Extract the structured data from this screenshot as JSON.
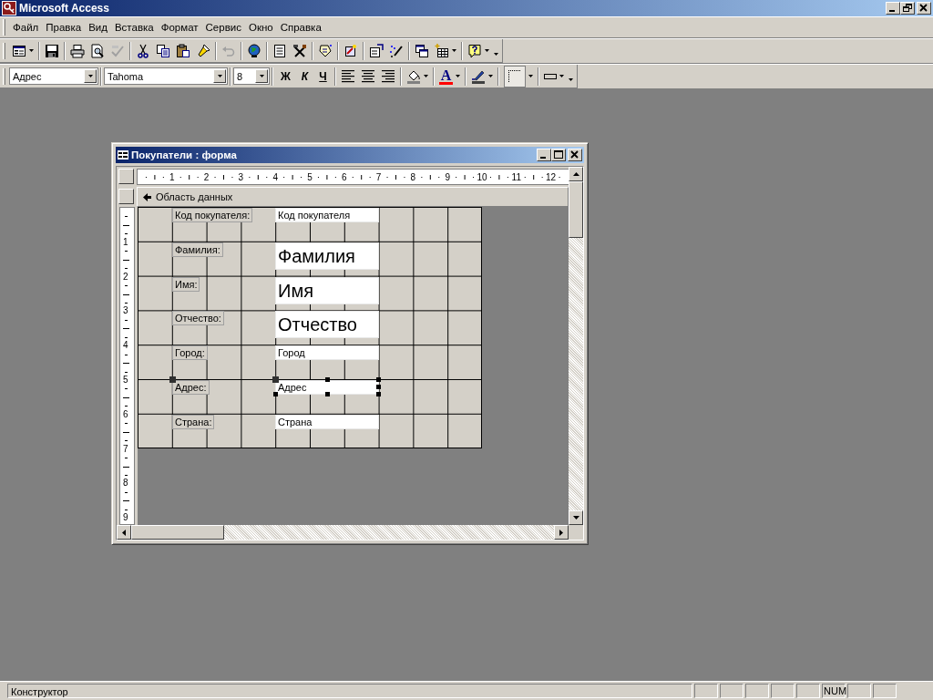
{
  "window": {
    "title": "Microsoft Access"
  },
  "menu": [
    {
      "label": "Файл"
    },
    {
      "label": "Правка"
    },
    {
      "label": "Вид"
    },
    {
      "label": "Вставка"
    },
    {
      "label": "Формат"
    },
    {
      "label": "Сервис"
    },
    {
      "label": "Окно"
    },
    {
      "label": "Справка"
    }
  ],
  "formatting": {
    "object": "Адрес",
    "font": "Tahoma",
    "size": "8",
    "style_buttons": [
      "Ж",
      "К",
      "Ч"
    ],
    "font_color_glyph": "A"
  },
  "form_window": {
    "title": "Покупатели : форма",
    "ruler_marks": [
      "1",
      "2",
      "3",
      "4",
      "5",
      "6",
      "7",
      "8",
      "9",
      "10",
      "11",
      "12"
    ],
    "vertical_marks": [
      "1",
      "2",
      "3",
      "4",
      "5",
      "6",
      "7",
      "8",
      "9"
    ],
    "section": "Область данных",
    "controls": [
      {
        "label": "Код покупателя:",
        "field": "Код покупателя",
        "kind": "small",
        "selected": false
      },
      {
        "label": "Фамилия:",
        "field": "Фамилия",
        "kind": "large",
        "selected": false
      },
      {
        "label": "Имя:",
        "field": "Имя",
        "kind": "large",
        "selected": false
      },
      {
        "label": "Отчество:",
        "field": "Отчество",
        "kind": "large",
        "selected": false
      },
      {
        "label": "Город:",
        "field": "Город",
        "kind": "small",
        "selected": false
      },
      {
        "label": "Адрес:",
        "field": "Адрес",
        "kind": "small",
        "selected": true
      },
      {
        "label": "Страна:",
        "field": "Страна",
        "kind": "small",
        "selected": false
      }
    ]
  },
  "status_bar": {
    "text": "Конструктор",
    "indicators": [
      "NUM"
    ]
  }
}
